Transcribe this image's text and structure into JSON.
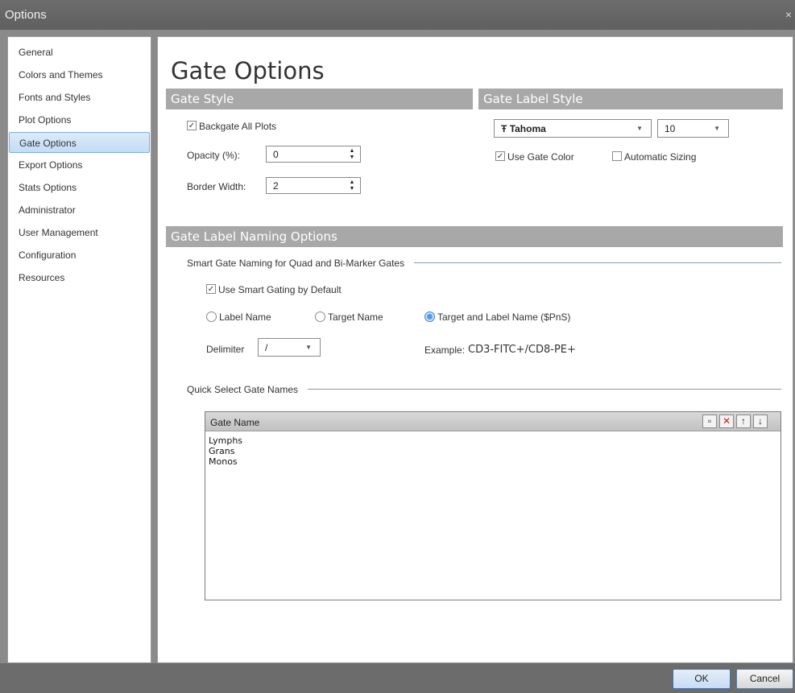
{
  "window": {
    "title": "Options",
    "close_glyph": "×"
  },
  "sidebar": {
    "items": [
      {
        "label": "General"
      },
      {
        "label": "Colors and Themes"
      },
      {
        "label": "Fonts and Styles"
      },
      {
        "label": "Plot Options"
      },
      {
        "label": "Gate Options",
        "active": true
      },
      {
        "label": "Export Options"
      },
      {
        "label": "Stats Options"
      },
      {
        "label": "Administrator"
      },
      {
        "label": "User Management"
      },
      {
        "label": "Configuration"
      },
      {
        "label": "Resources"
      }
    ]
  },
  "page": {
    "title": "Gate Options"
  },
  "gate_style": {
    "header": "Gate Style",
    "backgate_label": "Backgate All Plots",
    "backgate_checked": true,
    "opacity_label": "Opacity (%):",
    "opacity_value": "0",
    "border_label": "Border Width:",
    "border_value": "2"
  },
  "gate_label_style": {
    "header": "Gate Label Style",
    "font_glyph": "Ŧ",
    "font_value": "Tahoma",
    "size_value": "10",
    "use_gate_color_label": "Use Gate Color",
    "use_gate_color_checked": true,
    "auto_sizing_label": "Automatic Sizing",
    "auto_sizing_checked": false
  },
  "naming": {
    "header": "Gate Label Naming Options",
    "smart_group_label": "Smart Gate Naming for Quad and Bi-Marker Gates",
    "smart_default_label": "Use Smart Gating by Default",
    "smart_default_checked": true,
    "radio_label_name": "Label Name",
    "radio_target_name": "Target Name",
    "radio_target_label": "Target and Label Name ($PnS)",
    "selected_radio": "target_and_label",
    "delimiter_label": "Delimiter",
    "delimiter_value": "/",
    "example_label": "Example:",
    "example_value": "CD3-FITC+/CD8-PE+"
  },
  "quick_select": {
    "group_label": "Quick Select Gate Names",
    "column_header": "Gate Name",
    "rows": [
      "Lymphs",
      "Grans",
      "Monos"
    ]
  },
  "toolbar_icons": [
    "new-icon",
    "delete-icon",
    "move-up-icon",
    "move-down-icon"
  ],
  "footer": {
    "ok_label": "OK",
    "cancel_label": "Cancel"
  },
  "colors": {
    "accent": "#4c9be8",
    "section_bar": "#a8a8a8",
    "titlebar": "#666666"
  }
}
